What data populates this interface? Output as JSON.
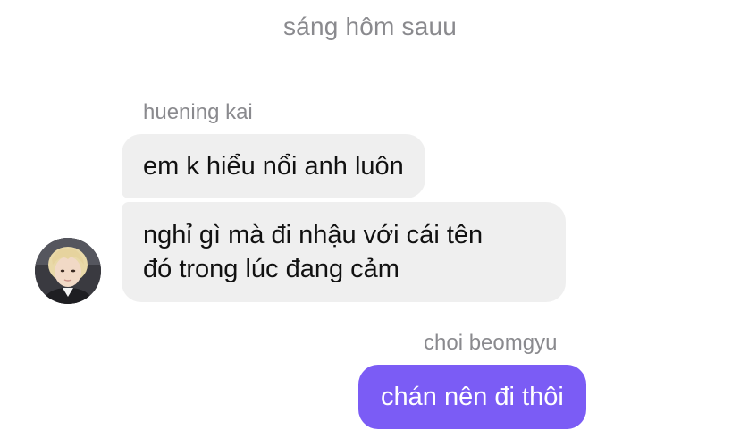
{
  "timestamp": "sáng hôm sauu",
  "incoming": {
    "sender": "huening kai",
    "messages": [
      "em k hiểu nổi anh luôn",
      "nghỉ gì mà đi nhậu với cái tên\nđó trong lúc đang cảm"
    ]
  },
  "outgoing": {
    "sender": "choi beomgyu",
    "messages": [
      "chán nên đi thôi"
    ]
  },
  "colors": {
    "incoming_bubble": "#efefef",
    "outgoing_bubble": "#7b5cf5",
    "meta_text": "#8a8a8e"
  },
  "icons": {
    "avatar": "avatar-photo"
  }
}
